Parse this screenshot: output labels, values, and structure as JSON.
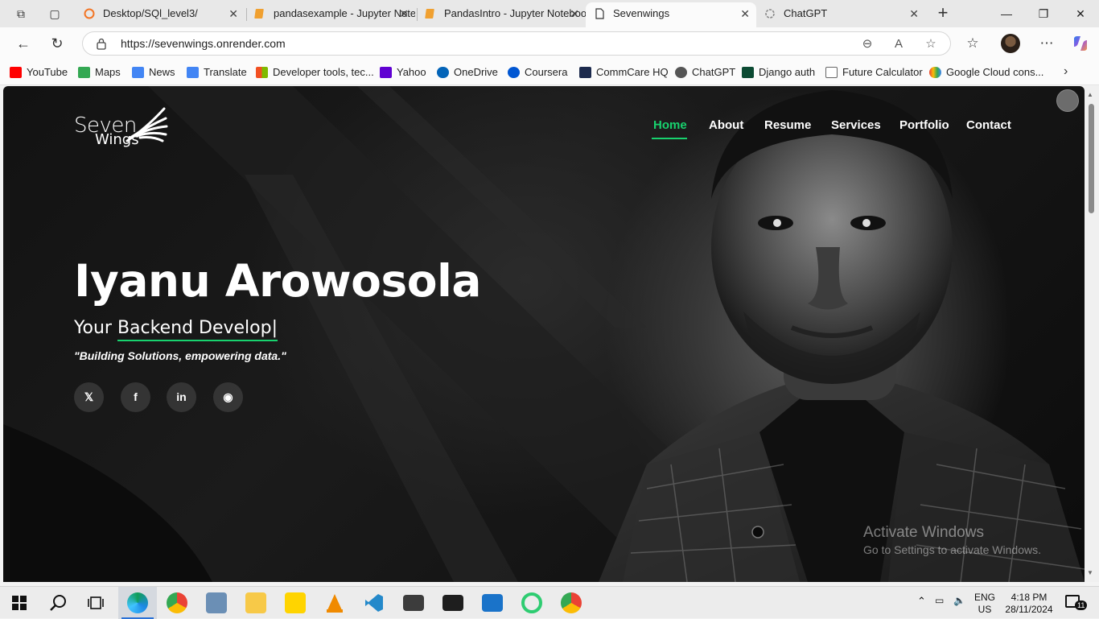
{
  "browser": {
    "tabs": [
      {
        "title": "Desktop/SQl_level3/",
        "icon": "jupyter-icon",
        "active": false
      },
      {
        "title": "pandasexample - Jupyter Notebook",
        "icon": "notebook-icon",
        "active": false
      },
      {
        "title": "PandasIntro - Jupyter Notebook",
        "icon": "notebook-icon",
        "active": false
      },
      {
        "title": "Sevenwings",
        "icon": "page-icon",
        "active": true
      },
      {
        "title": "ChatGPT",
        "icon": "chatgpt-icon",
        "active": false
      }
    ],
    "url": "https://sevenwings.onrender.com",
    "favorites": [
      {
        "label": "YouTube",
        "color": "#ff0000"
      },
      {
        "label": "Maps",
        "color": "#34a853"
      },
      {
        "label": "News",
        "color": "#4285f4"
      },
      {
        "label": "Translate",
        "color": "#4285f4"
      },
      {
        "label": "Developer tools, tec...",
        "color": "#f25022"
      },
      {
        "label": "Yahoo",
        "color": "#6001d2"
      },
      {
        "label": "OneDrive",
        "color": "#0364b8"
      },
      {
        "label": "Coursera",
        "color": "#0056d2"
      },
      {
        "label": "CommCare HQ",
        "color": "#1c2a4d"
      },
      {
        "label": "ChatGPT",
        "color": "#555555"
      },
      {
        "label": "Django auth",
        "color": "#0c4b33"
      },
      {
        "label": "Future Calculator",
        "color": "#666666"
      },
      {
        "label": "Google Cloud cons...",
        "color": "#fbbc05"
      }
    ]
  },
  "site": {
    "logo": {
      "line1": "Seven",
      "line2": "Wings"
    },
    "nav": [
      "Home",
      "About",
      "Resume",
      "Services",
      "Portfolio",
      "Contact"
    ],
    "active_nav": "Home",
    "accent": "#18d26e",
    "hero": {
      "name": "Iyanu Arowosola",
      "subtitle_prefix": "Your",
      "subtitle_typed": "Backend Develop|",
      "quote": "\"Building Solutions, empowering data.\""
    },
    "social": [
      {
        "name": "x-icon",
        "glyph": "𝕏"
      },
      {
        "name": "facebook-icon",
        "glyph": "f"
      },
      {
        "name": "linkedin-icon",
        "glyph": "in"
      },
      {
        "name": "github-icon",
        "glyph": "◉"
      }
    ]
  },
  "watermark": {
    "line1": "Activate Windows",
    "line2": "Go to Settings to activate Windows."
  },
  "taskbar": {
    "lang": "ENG",
    "region": "US",
    "time": "4:18 PM",
    "date": "28/11/2024",
    "notifications": "11"
  }
}
